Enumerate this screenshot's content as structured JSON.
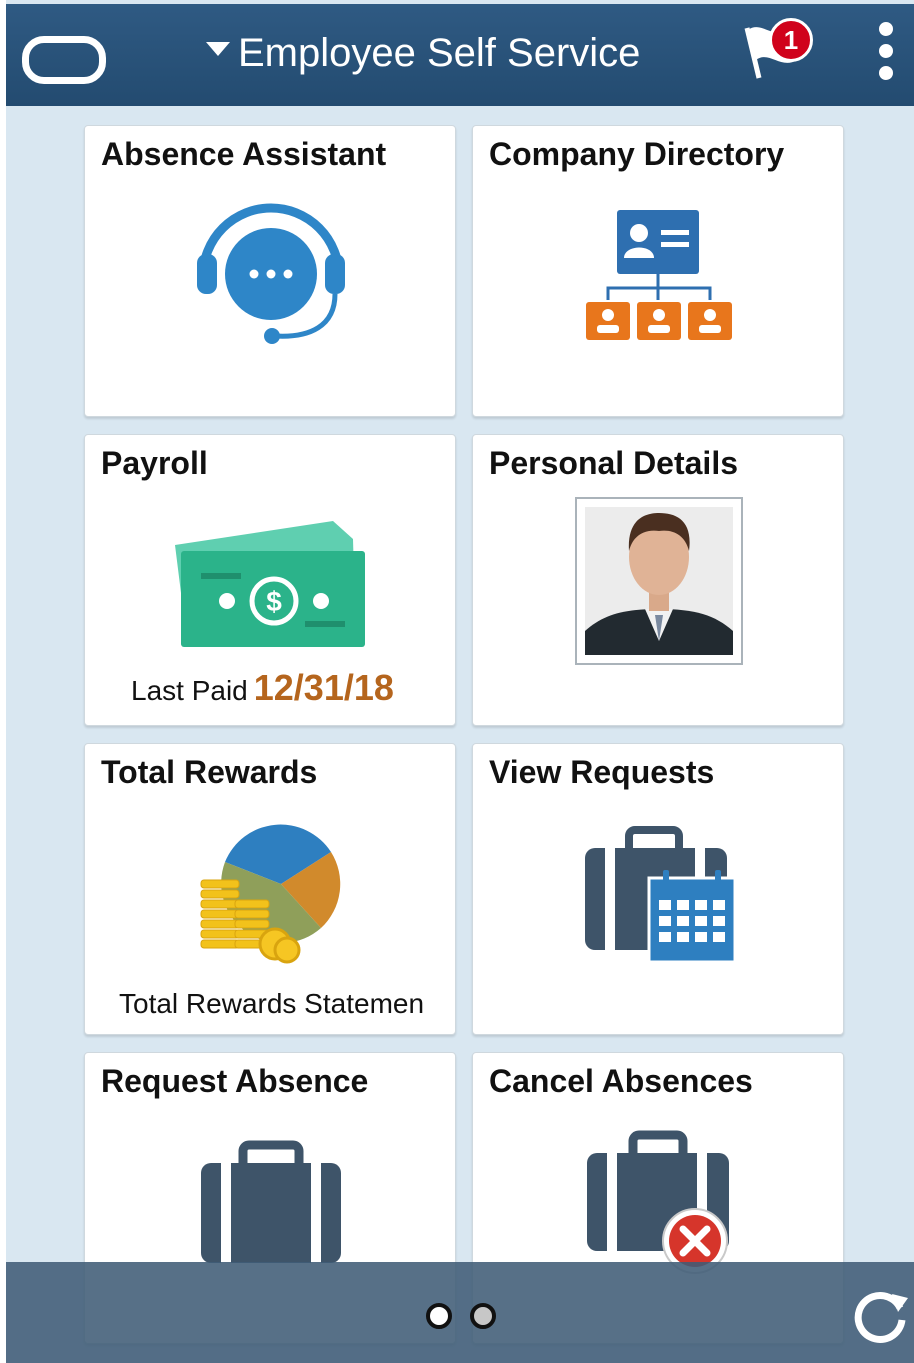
{
  "header": {
    "title": "Employee Self Service",
    "notification_count": "1",
    "icons": [
      "oracle-logo-icon",
      "caret-down-icon",
      "flag-icon",
      "more-vertical-icon"
    ]
  },
  "tiles": [
    {
      "title": "Absence Assistant",
      "icon": "headset-chat-icon"
    },
    {
      "title": "Company Directory",
      "icon": "org-chart-icon"
    },
    {
      "title": "Payroll",
      "icon": "money-icon",
      "last_paid_label": "Last Paid",
      "last_paid_date": "12/31/18"
    },
    {
      "title": "Personal Details",
      "icon": "employee-photo"
    },
    {
      "title": "Total Rewards",
      "icon": "pie-coins-icon",
      "subtitle": "Total Rewards Statemen"
    },
    {
      "title": "View Requests",
      "icon": "briefcase-calendar-icon"
    },
    {
      "title": "Request Absence",
      "icon": "briefcase-icon"
    },
    {
      "title": "Cancel Absences",
      "icon": "briefcase-cancel-icon"
    }
  ],
  "footer": {
    "page_count": 2,
    "current_page": 1,
    "refresh_icon": "refresh-icon"
  },
  "colors": {
    "header": "#2b5279",
    "accent_date": "#b5651d",
    "badge": "#d0021b",
    "background": "#d9e7f1"
  }
}
